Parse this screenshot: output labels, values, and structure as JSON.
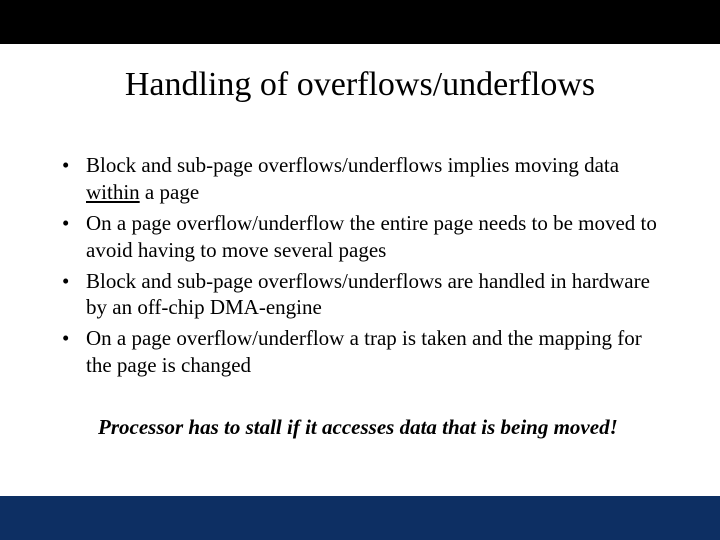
{
  "title": "Handling of overflows/underflows",
  "bullets": [
    {
      "pre": "Block and sub-page overflows/underflows implies moving data ",
      "u": "within",
      "post": " a page"
    },
    {
      "pre": "On a page overflow/underflow the entire page needs to be moved to avoid having to move several pages",
      "u": "",
      "post": ""
    },
    {
      "pre": "Block and sub-page overflows/underflows are handled in hardware by an off-chip DMA-engine",
      "u": "",
      "post": ""
    },
    {
      "pre": "On a page overflow/underflow a trap is taken and the mapping for the page is changed",
      "u": "",
      "post": ""
    }
  ],
  "footnote": "Processor has to stall if it accesses data that is being moved!"
}
